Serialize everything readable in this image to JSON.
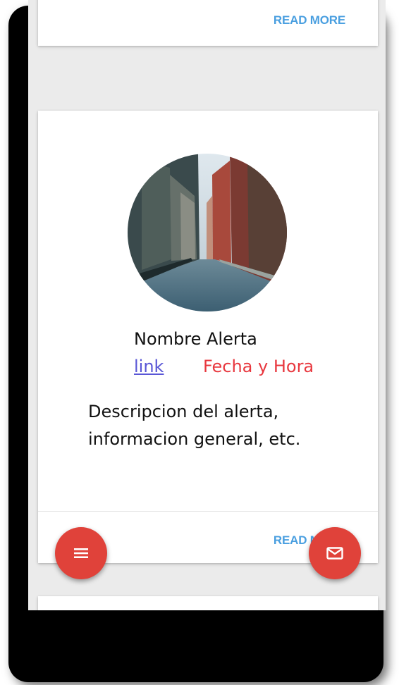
{
  "cards": [
    {
      "read_more_label": "READ MORE"
    },
    {
      "alert_name": "Nombre Alerta",
      "link_label": "link",
      "date_label": "Fecha y Hora",
      "description": "Descripcion del alerta, informacion general, etc.",
      "read_more_label": "READ MORE"
    }
  ],
  "fabs": {
    "menu_icon": "menu-icon",
    "mail_icon": "mail-icon"
  },
  "colors": {
    "accent_fab": "#e0423a",
    "read_more": "#4a9fe0",
    "link": "#5a57d6",
    "date": "#e8383f",
    "background": "#ebebeb"
  }
}
